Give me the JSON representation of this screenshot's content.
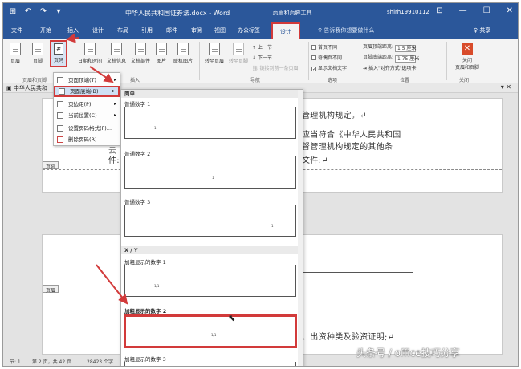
{
  "title_bar": {
    "quick_access": [
      "⊞",
      "↶",
      "↷",
      "▾"
    ],
    "doc_title": "中华人民共和国证券法.docx - Word",
    "context_tool": "页眉和页脚工具",
    "user": "shirh19910112",
    "win_buttons": [
      "⊡",
      "—",
      "☐",
      "✕"
    ]
  },
  "tabs": [
    "文件",
    "开始",
    "插入",
    "设计",
    "布局",
    "引用",
    "邮件",
    "审阅",
    "视图",
    "办公标签"
  ],
  "active_tab": "设计",
  "tell_me": "♀ 告诉我你想要做什么",
  "share": "♀ 共享",
  "ribbon": {
    "header_footer": {
      "header": "页眉",
      "footer": "页脚",
      "page_number": "页码",
      "group": "页眉和页脚"
    },
    "insert": {
      "date_time": "日期和时间",
      "doc_info": "文档信息",
      "doc_parts": "文档部件",
      "picture": "图片",
      "online_picture": "联机图片",
      "group": "插入"
    },
    "navigation": {
      "goto_header": "转至页眉",
      "goto_footer": "转至页脚",
      "prev": "上一节",
      "next": "下一节",
      "link_prev": "链接到前一条页眉",
      "group": "导航"
    },
    "options": {
      "first_page_diff": "首页不同",
      "odd_even_diff": "奇偶页不同",
      "show_doc_text": "显示文档文字",
      "group": "选项"
    },
    "position": {
      "header_top": "页眉顶端距离:",
      "header_value": "1.5 厘米",
      "footer_bottom": "页脚底端距离:",
      "footer_value": "1.75 厘米",
      "insert_align_tab": "插入\"对齐方式\"选项卡",
      "group": "位置"
    },
    "close": {
      "label": "关闭\n页眉和页脚",
      "group": "关闭"
    }
  },
  "nav_strip": {
    "doc_tab": "中华人民共和",
    "controls": "▾ ✕"
  },
  "page_menu": {
    "items": [
      {
        "label": "页面顶端(T)",
        "submenu": true
      },
      {
        "label": "页面底端(B)",
        "submenu": true
      },
      {
        "label": "页边距(P)",
        "submenu": true
      },
      {
        "label": "当前位置(C)",
        "submenu": true
      },
      {
        "label": "设置页码格式(F)...",
        "submenu": false
      },
      {
        "label": "删除页码(R)",
        "submenu": false
      }
    ],
    "active_index": 1
  },
  "gallery": {
    "category_simple": "简单",
    "category_xy": "X / Y",
    "items": [
      {
        "label": "普通数字 1",
        "num": "1"
      },
      {
        "label": "普通数字 2",
        "num": "1"
      },
      {
        "label": "普通数字 3",
        "num": "1"
      },
      {
        "label": "加粗显示的数字 1",
        "num": "1/1"
      },
      {
        "label": "加粗显示的数字 2",
        "num": "1/1"
      },
      {
        "label": "加粗显示的数字 3",
        "num": ""
      }
    ],
    "selected_index": 4
  },
  "document": {
    "page1_lines": [
      "管理机构规定。↵",
      "应当符合《中华人民共和国",
      "督管理机构规定的其他条",
      "件:",
      "文件:↵"
    ],
    "page1_prefix": "云",
    "footer_label": "页脚",
    "header_label": "页眉",
    "page2_line": "、出资种类及验资证明;↵"
  },
  "status_bar": {
    "section": "节: 1",
    "page": "第 2 页，共 42 页",
    "words": "28423 个字"
  },
  "watermark": "头条号 / office技巧分享"
}
